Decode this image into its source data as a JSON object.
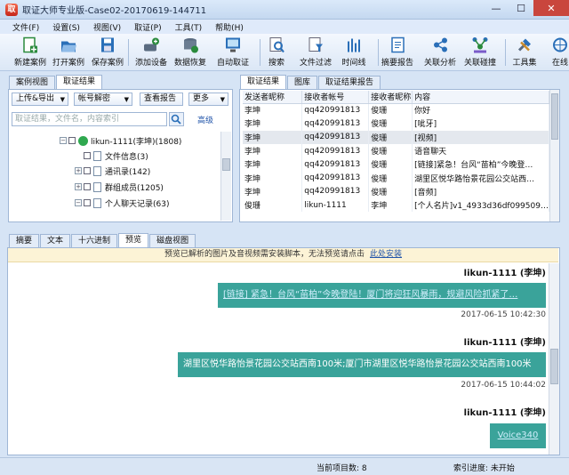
{
  "window": {
    "title": "取证大师专业版-Case02-20170619-144711",
    "controls": [
      "—",
      "☐",
      "✕"
    ]
  },
  "menu": [
    "文件(F)",
    "设置(S)",
    "视图(V)",
    "取证(P)",
    "工具(T)",
    "帮助(H)"
  ],
  "toolbar": [
    {
      "label": "新建案例",
      "icon": "new-case-icon",
      "color": "#2a8a3c"
    },
    {
      "label": "打开案例",
      "icon": "open-case-icon",
      "color": "#2a6fb8"
    },
    {
      "label": "保存案例",
      "icon": "save-case-icon",
      "color": "#2a6fb8"
    },
    {
      "label": "添加设备",
      "icon": "add-device-icon",
      "color": "#2a8a3c"
    },
    {
      "label": "数据恢复",
      "icon": "data-recovery-icon",
      "color": "#2a8a3c"
    },
    {
      "label": "自动取证",
      "icon": "auto-forensics-icon",
      "color": "#2a6fb8"
    },
    {
      "label": "搜索",
      "icon": "search-icon",
      "color": "#2a6fb8"
    },
    {
      "label": "文件过滤",
      "icon": "file-filter-icon",
      "color": "#2a6fb8"
    },
    {
      "label": "时间线",
      "icon": "timeline-icon",
      "color": "#2a6fb8"
    },
    {
      "label": "摘要报告",
      "icon": "summary-report-icon",
      "color": "#2a6fb8"
    },
    {
      "label": "关联分析",
      "icon": "link-analysis-icon",
      "color": "#2a6fb8"
    },
    {
      "label": "关联碰撞",
      "icon": "link-collision-icon",
      "color": "#2a8a3c"
    },
    {
      "label": "工具集",
      "icon": "toolset-icon",
      "color": "#2a6fb8"
    },
    {
      "label": "在线",
      "icon": "online-icon",
      "color": "#2a6fb8"
    }
  ],
  "left": {
    "tabs": [
      "案例视图",
      "取证结果"
    ],
    "buttons": [
      "上传&导出",
      "帐号解密",
      "查看报告",
      "更多"
    ],
    "search_placeholder": "取证结果，文件名，内容索引",
    "advanced": "高级",
    "tree": [
      {
        "label": "likun-1111(李坤)(1808)",
        "level": 0,
        "type": "account"
      },
      {
        "label": "文件信息(3)",
        "level": 1,
        "type": "doc"
      },
      {
        "label": "通讯录(142)",
        "level": 1,
        "type": "doc",
        "expander": "+"
      },
      {
        "label": "群组成员(1205)",
        "level": 1,
        "type": "doc",
        "expander": "+"
      },
      {
        "label": "个人聊天记录(63)",
        "level": 1,
        "type": "doc",
        "expander": "-"
      }
    ]
  },
  "right": {
    "tabs": [
      "取证结果",
      "图库",
      "取证结果报告"
    ],
    "columns": [
      "发送者昵称",
      "接收者帐号",
      "接收者昵称",
      "内容"
    ],
    "rows": [
      [
        "李坤",
        "qq420991813",
        "俊珊",
        "你好"
      ],
      [
        "李坤",
        "qq420991813",
        "俊珊",
        "[呲牙]"
      ],
      [
        "李坤",
        "qq420991813",
        "俊珊",
        "[视频]"
      ],
      [
        "李坤",
        "qq420991813",
        "俊珊",
        "语音聊天"
      ],
      [
        "李坤",
        "qq420991813",
        "俊珊",
        "[链接]紧急！台风“苗柏”今晚登…"
      ],
      [
        "李坤",
        "qq420991813",
        "俊珊",
        "湖里区悦华路怡景花园公交站西…"
      ],
      [
        "李坤",
        "qq420991813",
        "俊珊",
        "[音频]"
      ],
      [
        "俊珊",
        "likun-1111",
        "李坤",
        "[个人名片]v1_4933d36df099509…"
      ]
    ]
  },
  "bottom": {
    "tabs": [
      "摘要",
      "文本",
      "十六进制",
      "预览",
      "磁盘视图"
    ],
    "notice": "预览已解析的图片及音视频需安装脚本，无法预览请点击",
    "notice_link": "此处安装",
    "messages": [
      {
        "sender": "likun-1111 (李坤)",
        "text": "[链接] 紧急！台风“苗柏”今晚登陆！厦门将迎狂风暴雨，规避风险抓紧了…",
        "time": "2017-06-15 10:42:30"
      },
      {
        "sender": "likun-1111 (李坤)",
        "text": "湖里区悦华路怡景花园公交站西南100米;厦门市湖里区悦华路怡景花园公交站西南100米",
        "time": "2017-06-15 10:44:02"
      },
      {
        "sender": "likun-1111 (李坤)",
        "text": "Voice340",
        "time": ""
      }
    ]
  },
  "status": {
    "page_items": "当前项目数: 8",
    "index": "索引进度: 未开始"
  }
}
